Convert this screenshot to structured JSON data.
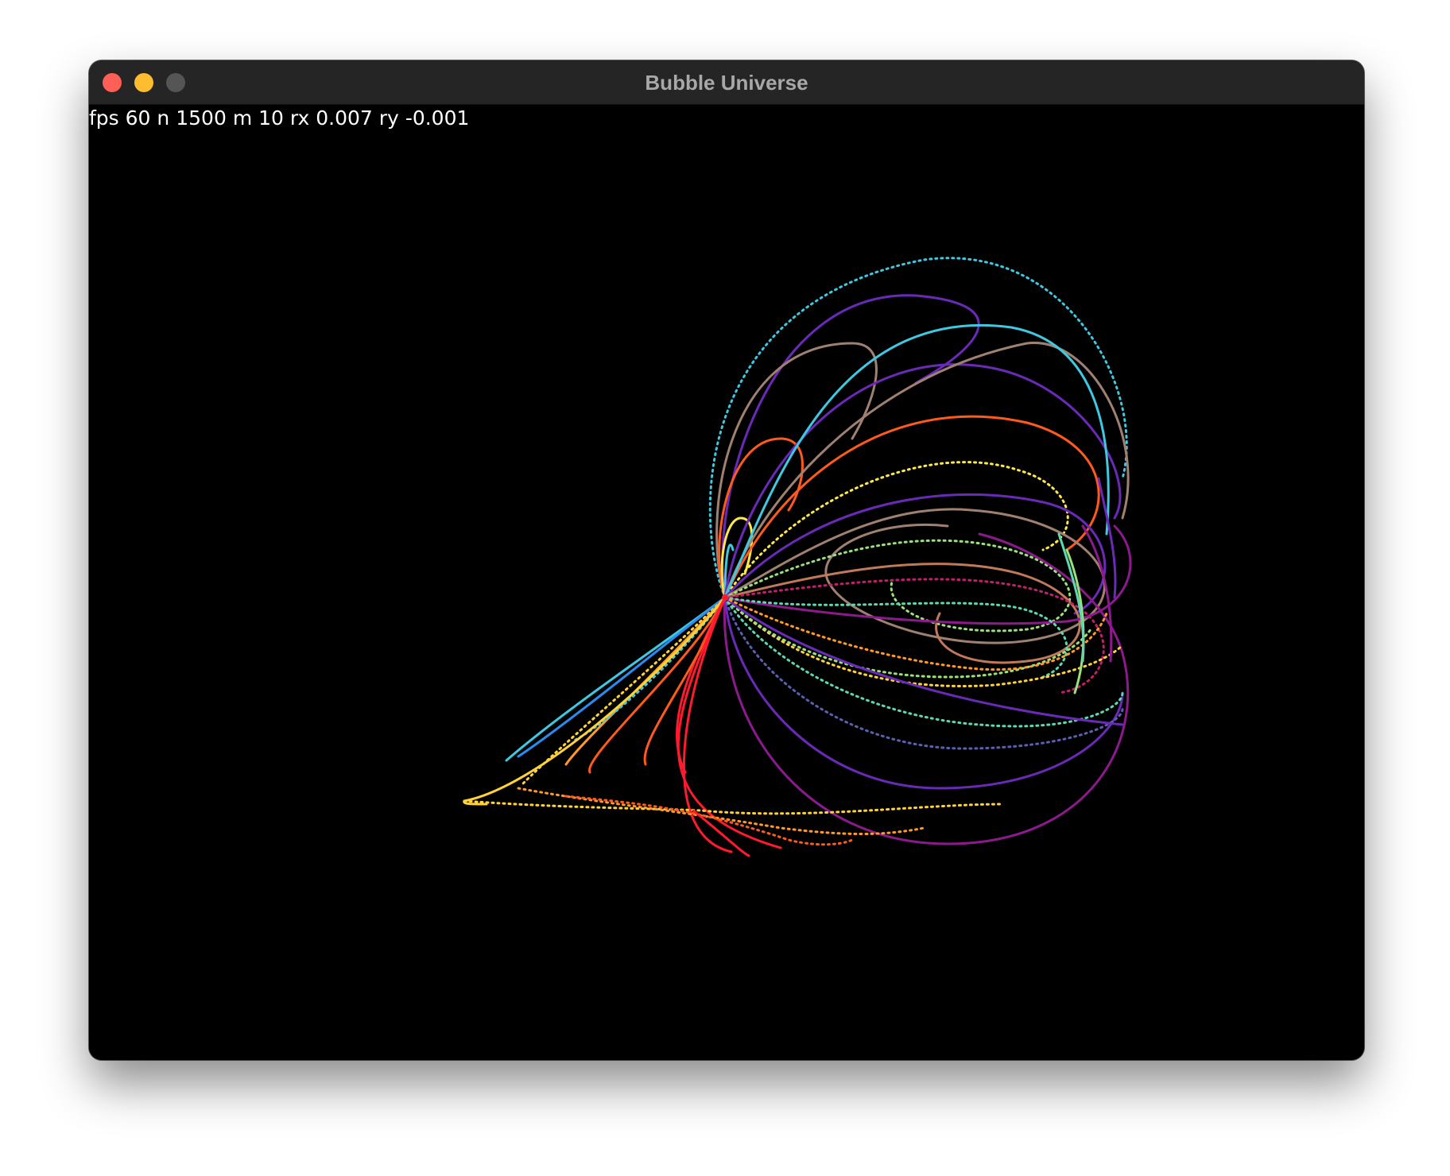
{
  "window": {
    "title": "Bubble Universe"
  },
  "stats": {
    "fps_label": "fps",
    "fps": "60",
    "n_label": "n",
    "n": "1500",
    "m_label": "m",
    "m": "10",
    "rx_label": "rx",
    "rx": "0.007",
    "ry_label": "ry",
    "ry": "-0.001"
  },
  "colors": {
    "titlebar": "#252525",
    "close": "#ff5f57",
    "minimize": "#febc2e",
    "zoom": "#555555",
    "canvas": "#000000",
    "palette": [
      "#ff1a2e",
      "#ff5a1e",
      "#ff9a2a",
      "#ffd23a",
      "#ffe84a",
      "#9be07a",
      "#5fd8b0",
      "#3fc8e0",
      "#2a8cf0",
      "#3040e0",
      "#6a2ab8",
      "#8c1a8c",
      "#c0206a",
      "#a08070",
      "#c07a5a"
    ]
  },
  "icons": {
    "close": "close-icon",
    "minimize": "minimize-icon",
    "zoom": "zoom-icon"
  }
}
